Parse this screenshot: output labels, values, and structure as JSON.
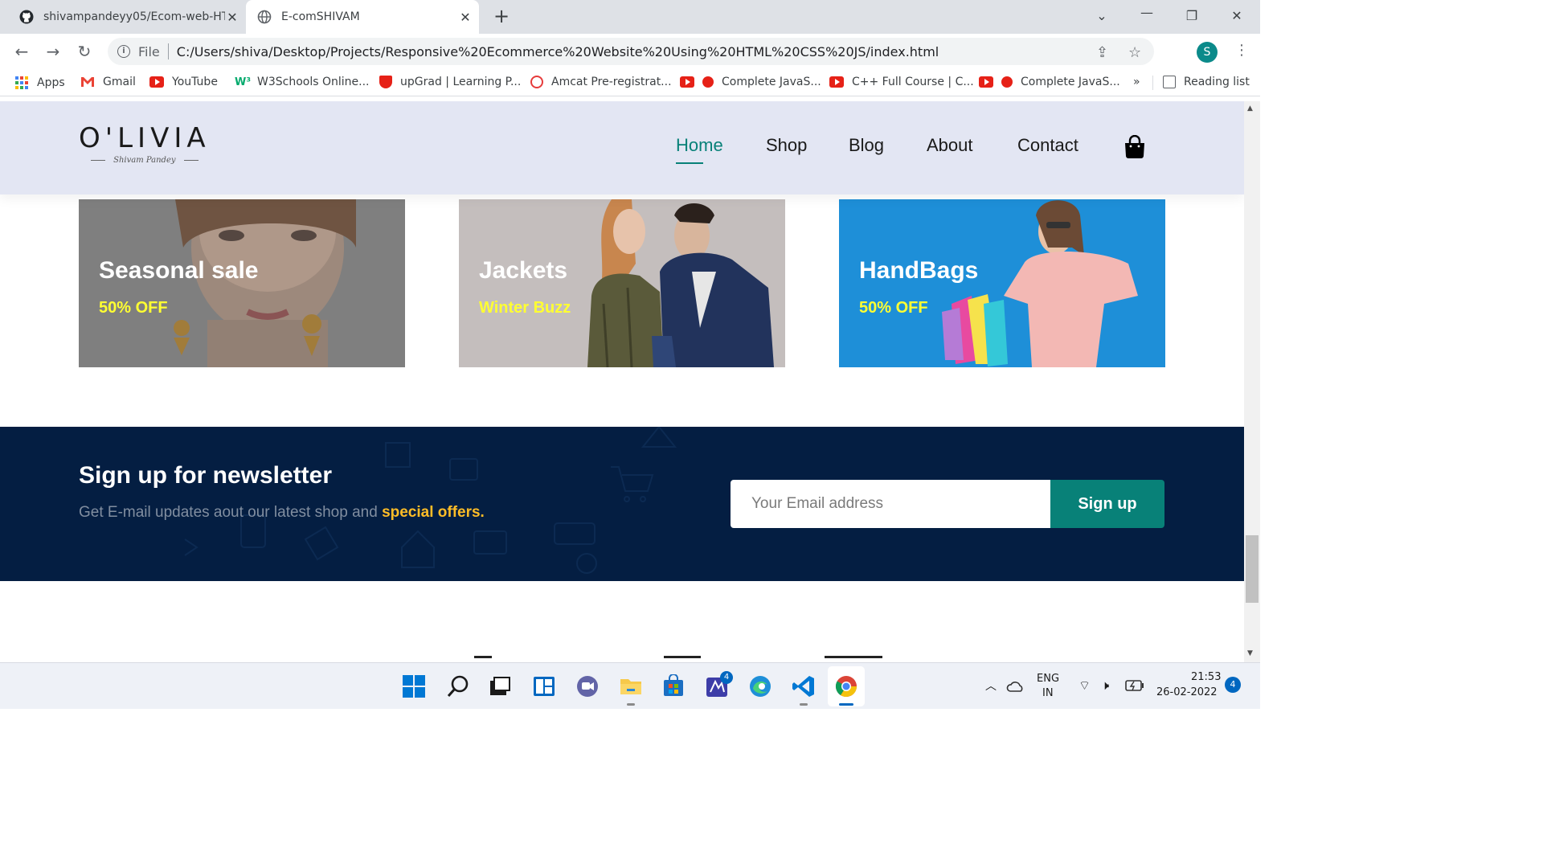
{
  "browser": {
    "tabs": [
      {
        "title": "shivampandeyy05/Ecom-web-HT",
        "active": false
      },
      {
        "title": "E-comSHIVAM",
        "active": true
      }
    ],
    "file_label": "File",
    "url": "C:/Users/shiva/Desktop/Projects/Responsive%20Ecommerce%20Website%20Using%20HTML%20CSS%20JS/index.html",
    "profile_initial": "S",
    "bookmarks": [
      {
        "label": "Apps",
        "icon": "apps-grid-icon"
      },
      {
        "label": "Gmail",
        "icon": "gmail-icon"
      },
      {
        "label": "YouTube",
        "icon": "youtube-icon"
      },
      {
        "label": "W3Schools Online...",
        "icon": "w3schools-icon"
      },
      {
        "label": "upGrad | Learning P...",
        "icon": "upgrad-icon"
      },
      {
        "label": "Amcat Pre-registrat...",
        "icon": "amcat-icon"
      },
      {
        "label": "Complete JavaS...",
        "icon": "youtube-icon"
      },
      {
        "label": "C++ Full Course | C...",
        "icon": "youtube-icon"
      },
      {
        "label": "Complete JavaS...",
        "icon": "youtube-icon"
      }
    ],
    "more_bookmarks": "»",
    "reading_list": "Reading list"
  },
  "site": {
    "logo": {
      "main": "O'LIVIA",
      "sub": "Shivam Pandey"
    },
    "nav": [
      "Home",
      "Shop",
      "Blog",
      "About",
      "Contact"
    ],
    "active_nav": "Home",
    "accent": "#088178",
    "banners": [
      {
        "title": "Seasonal sale",
        "subtitle": "50% OFF"
      },
      {
        "title": "Jackets",
        "subtitle": "Winter Buzz"
      },
      {
        "title": "HandBags",
        "subtitle": "50% OFF"
      }
    ],
    "newsletter": {
      "title": "Sign up for newsletter",
      "text": "Get E-mail updates aout our latest shop and",
      "highlight": "special offers.",
      "placeholder": "Your Email address",
      "button": "Sign up"
    }
  },
  "taskbar": {
    "store_badge": "4",
    "lang": "ENG",
    "region": "IN",
    "time": "21:53",
    "date": "26-02-2022",
    "notifications": "4"
  }
}
